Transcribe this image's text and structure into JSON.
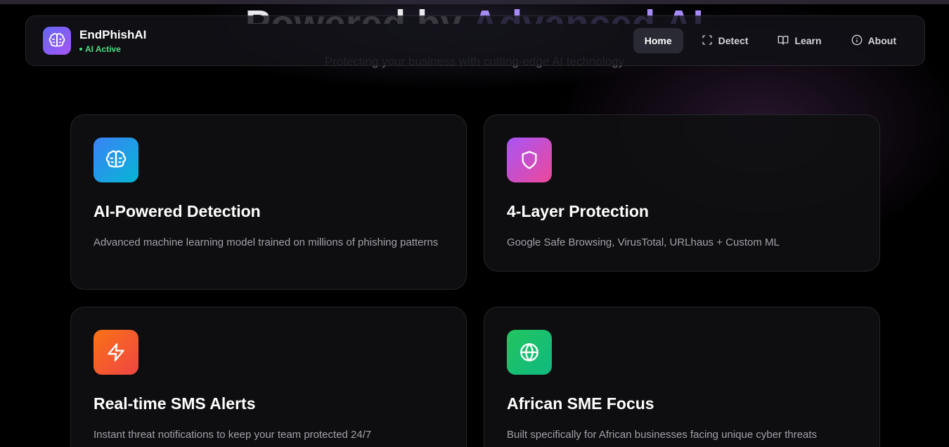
{
  "hero": {
    "title_start": "Powered by",
    "title_accent": "Advanced AI",
    "subtitle": "Protecting your business with cutting-edge AI technology"
  },
  "brand": {
    "name": "EndPhishAI",
    "status": "AI Active",
    "status_color": "#4ade80"
  },
  "nav": {
    "items": [
      {
        "label": "Home",
        "icon": "home",
        "active": true
      },
      {
        "label": "Detect",
        "icon": "scan-icon"
      },
      {
        "label": "Learn",
        "icon": "book-icon"
      },
      {
        "label": "About",
        "icon": "info-icon"
      }
    ]
  },
  "features": [
    {
      "title": "AI-Powered Detection",
      "description": "Advanced machine learning model trained on millions of phishing patterns",
      "icon": "brain-icon",
      "color": "#3b82f6"
    },
    {
      "title": "4-Layer Protection",
      "description": "Google Safe Browsing, VirusTotal, URLhaus + Custom ML",
      "icon": "shield-icon",
      "color": "#a855f7"
    },
    {
      "title": "Real-time SMS Alerts",
      "description": "Instant threat notifications to keep your team protected 24/7",
      "icon": "zap-icon",
      "color": "#f97316"
    },
    {
      "title": "African SME Focus",
      "description": "Built specifically for African businesses facing unique cyber threats",
      "icon": "globe-icon",
      "color": "#22c55e"
    }
  ]
}
